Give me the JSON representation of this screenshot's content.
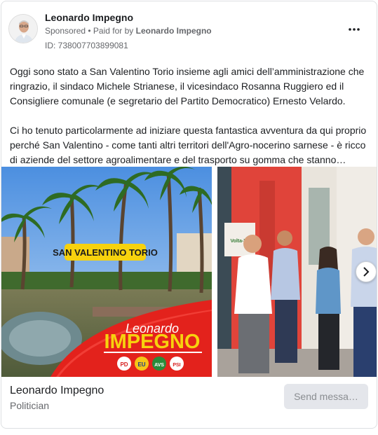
{
  "post": {
    "page_name": "Leonardo Impegno",
    "sponsored_label": "Sponsored",
    "paid_for_prefix": " • Paid for by ",
    "paid_for_name": "Leonardo Impegno",
    "ad_id": "ID: 738007703899081",
    "more_icon": "more-horizontal-icon"
  },
  "body": {
    "paragraph1": "Oggi sono stato a San Valentino Torio insieme agli amici dell’amministrazione che ringrazio, il sindaco Michele Strianese, il vicesindaco Rosanna Ruggiero ed il Consigliere comunale (e segretario del Partito Democratico) Ernesto Velardo.",
    "paragraph2": "Ci ho tenuto particolarmente ad iniziare questa fantastica avventura da qui proprio perché San Valentino - come tanti altri territori dell'Agro-nocerino sarnese - è ricco di aziende del settore agroalimentare e del trasporto su gomma che stanno…"
  },
  "carousel": {
    "slide1": {
      "place_label": "SAN VALENTINO TORIO",
      "first_name": "Leonardo",
      "surname": "IMPEGNO",
      "party_logos": [
        "PD",
        "EU",
        "AVS",
        "PSI"
      ]
    },
    "slide2": {
      "shop_sign": "Volta-Ve"
    },
    "next_icon": "chevron-right-icon"
  },
  "footer": {
    "name": "Leonardo Impegno",
    "category": "Politician",
    "send_button": "Send messa…"
  },
  "colors": {
    "brand_red": "#e3221c",
    "banner_yellow": "#f7d20e",
    "muted_text": "#65676b",
    "button_bg": "#e4e6eb"
  }
}
